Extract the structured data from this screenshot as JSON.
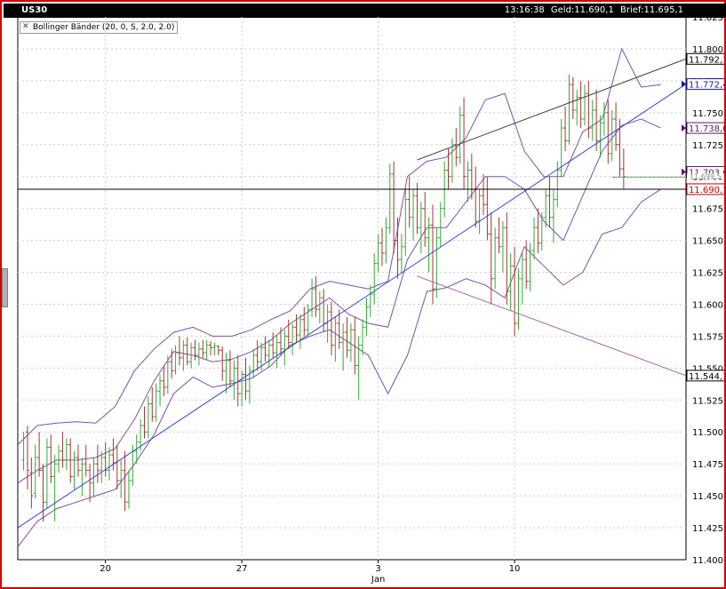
{
  "header": {
    "symbol": "US30",
    "time": "13:16:38",
    "geld": "Geld:11.690,1",
    "brief": "Brief:11.695,1"
  },
  "legend": {
    "label": "Bollinger Bänder (20, 0, S, 2.0, 2.0)"
  },
  "colors": {
    "frame": "#d40000",
    "up_bar": "#33aa33",
    "down_bar": "#aa3333",
    "bollinger": "#8050a8",
    "trend_blue": "#3048d0",
    "resistance": "#404040",
    "support": "#a060a8",
    "price_line": "#000000"
  },
  "chart_data": {
    "type": "line",
    "title": "",
    "xlabel": "",
    "ylabel": "",
    "ylim": [
      11400,
      11825
    ],
    "y_ticks": [
      "11.825,0",
      "11.800,0",
      "11.775,0",
      "11.750,0",
      "11.725,0",
      "11.700,0",
      "11.675,0",
      "11.650,0",
      "11.625,0",
      "11.600,0",
      "11.575,0",
      "11.550,0",
      "11.525,0",
      "11.500,0",
      "11.475,0",
      "11.450,0",
      "11.425,0",
      "11.400,0"
    ],
    "y_tick_values": [
      11825,
      11800,
      11775,
      11750,
      11725,
      11700,
      11675,
      11650,
      11625,
      11600,
      11575,
      11550,
      11525,
      11500,
      11475,
      11450,
      11425,
      11400
    ],
    "x_ticks": [
      {
        "label": "20",
        "x": 20
      },
      {
        "label": "27",
        "x": 27
      },
      {
        "label": "3",
        "x": 34
      },
      {
        "label": "10",
        "x": 41
      }
    ],
    "month_label": {
      "label": "Jan",
      "x": 34
    },
    "xlim": [
      15.5,
      49.8
    ],
    "grid": true,
    "price_levels": [
      {
        "label": "11.792,1",
        "value": 11792.1,
        "style": "plain"
      },
      {
        "label": "11.772,4",
        "value": 11772.4,
        "style": "blue"
      },
      {
        "label": "11.738,0",
        "value": 11738.0,
        "style": "marker"
      },
      {
        "label": "11.703,6",
        "value": 11703.6,
        "style": "marker"
      },
      {
        "label": "11.699,5",
        "value": 11699.5,
        "style": "hidden"
      },
      {
        "label": "11.690,1",
        "value": 11690.1,
        "style": "current"
      },
      {
        "label": "11.544,1",
        "value": 11544.1,
        "style": "plain"
      }
    ],
    "trend_lines": [
      {
        "name": "blue-trend",
        "points": [
          [
            15.5,
            11425
          ],
          [
            49.8,
            11772.4
          ]
        ]
      },
      {
        "name": "upper-channel",
        "points": [
          [
            36.0,
            11713
          ],
          [
            49.8,
            11792.1
          ]
        ]
      },
      {
        "name": "lower-channel",
        "points": [
          [
            36.0,
            11622
          ],
          [
            49.8,
            11544.1
          ]
        ]
      }
    ],
    "horizontal_lines": [
      {
        "name": "current-price",
        "value": 11690.1
      },
      {
        "name": "bid-level",
        "value": 11699.5,
        "from_x": 46.0
      }
    ],
    "bollinger": {
      "x": [
        15.5,
        16.5,
        17.5,
        18.5,
        19.5,
        20.5,
        21.5,
        22.5,
        23.5,
        24.5,
        25.5,
        26.5,
        27.5,
        28.5,
        29.5,
        30.5,
        31.5,
        32.5,
        33.5,
        34.5,
        35.5,
        36.5,
        37.5,
        38.5,
        39.5,
        40.5,
        41.5,
        42.5,
        43.5,
        44.5,
        45.5,
        46.5,
        47.5,
        48.5
      ],
      "upper": [
        11490,
        11505,
        11507,
        11508,
        11507,
        11520,
        11548,
        11565,
        11578,
        11582,
        11575,
        11575,
        11580,
        11588,
        11595,
        11612,
        11618,
        11615,
        11612,
        11618,
        11700,
        11712,
        11715,
        11730,
        11760,
        11765,
        11720,
        11700,
        11700,
        11735,
        11745,
        11800,
        11770,
        11772
      ],
      "middle": [
        11460,
        11470,
        11478,
        11478,
        11480,
        11487,
        11510,
        11540,
        11563,
        11560,
        11555,
        11557,
        11563,
        11572,
        11585,
        11595,
        11605,
        11592,
        11585,
        11582,
        11635,
        11660,
        11660,
        11680,
        11700,
        11700,
        11690,
        11665,
        11650,
        11685,
        11720,
        11740,
        11745,
        11738
      ],
      "lower": [
        11410,
        11430,
        11440,
        11445,
        11450,
        11455,
        11475,
        11498,
        11530,
        11543,
        11535,
        11538,
        11542,
        11552,
        11568,
        11575,
        11580,
        11570,
        11560,
        11530,
        11560,
        11610,
        11613,
        11620,
        11615,
        11605,
        11645,
        11630,
        11615,
        11625,
        11655,
        11660,
        11680,
        11690
      ]
    },
    "candles": [
      [
        15.8,
        11478,
        11500,
        11470,
        11495
      ],
      [
        16.0,
        11500,
        11505,
        11455,
        11470
      ],
      [
        16.2,
        11468,
        11480,
        11440,
        11450
      ],
      [
        16.4,
        11452,
        11490,
        11448,
        11480
      ],
      [
        16.6,
        11480,
        11500,
        11465,
        11470
      ],
      [
        16.8,
        11470,
        11475,
        11430,
        11445
      ],
      [
        17.0,
        11445,
        11495,
        11440,
        11488
      ],
      [
        17.2,
        11488,
        11498,
        11460,
        11465
      ],
      [
        17.4,
        11465,
        11482,
        11430,
        11475
      ],
      [
        17.6,
        11475,
        11490,
        11468,
        11485
      ],
      [
        17.8,
        11485,
        11500,
        11472,
        11478
      ],
      [
        18.0,
        11478,
        11495,
        11470,
        11490
      ],
      [
        18.2,
        11490,
        11495,
        11460,
        11465
      ],
      [
        18.4,
        11465,
        11485,
        11455,
        11480
      ],
      [
        18.6,
        11480,
        11490,
        11465,
        11470
      ],
      [
        18.8,
        11470,
        11480,
        11450,
        11475
      ],
      [
        19.0,
        11475,
        11490,
        11465,
        11470
      ],
      [
        19.2,
        11470,
        11475,
        11445,
        11460
      ],
      [
        19.4,
        11460,
        11480,
        11450,
        11475
      ],
      [
        19.6,
        11475,
        11490,
        11460,
        11470
      ],
      [
        19.8,
        11470,
        11485,
        11460,
        11480
      ],
      [
        20.0,
        11480,
        11492,
        11465,
        11470
      ],
      [
        20.2,
        11470,
        11488,
        11462,
        11482
      ],
      [
        20.4,
        11482,
        11495,
        11470,
        11476
      ],
      [
        20.6,
        11476,
        11490,
        11455,
        11462
      ],
      [
        20.8,
        11462,
        11478,
        11448,
        11470
      ],
      [
        21.0,
        11470,
        11485,
        11438,
        11445
      ],
      [
        21.2,
        11445,
        11470,
        11440,
        11462
      ],
      [
        21.4,
        11462,
        11490,
        11458,
        11485
      ],
      [
        21.6,
        11485,
        11498,
        11475,
        11492
      ],
      [
        21.8,
        11492,
        11510,
        11485,
        11505
      ],
      [
        22.0,
        11505,
        11520,
        11495,
        11500
      ],
      [
        22.2,
        11500,
        11528,
        11495,
        11522
      ],
      [
        22.4,
        11522,
        11535,
        11508,
        11512
      ],
      [
        22.6,
        11512,
        11538,
        11508,
        11532
      ],
      [
        22.8,
        11532,
        11545,
        11520,
        11540
      ],
      [
        23.0,
        11540,
        11552,
        11528,
        11535
      ],
      [
        23.2,
        11535,
        11560,
        11530,
        11555
      ],
      [
        23.4,
        11555,
        11565,
        11542,
        11548
      ],
      [
        23.6,
        11548,
        11568,
        11545,
        11562
      ],
      [
        23.8,
        11562,
        11575,
        11552,
        11558
      ],
      [
        24.0,
        11558,
        11572,
        11548,
        11568
      ],
      [
        24.2,
        11568,
        11574,
        11552,
        11555
      ],
      [
        24.4,
        11555,
        11570,
        11550,
        11566
      ],
      [
        24.6,
        11566,
        11572,
        11556,
        11560
      ],
      [
        24.8,
        11560,
        11570,
        11552,
        11565
      ],
      [
        25.0,
        11565,
        11572,
        11558,
        11562
      ],
      [
        25.2,
        11562,
        11572,
        11556,
        11568
      ],
      [
        25.4,
        11568,
        11571,
        11560,
        11566
      ],
      [
        25.6,
        11566,
        11570,
        11560,
        11567
      ],
      [
        25.8,
        11567,
        11568,
        11560,
        11564
      ],
      [
        26.0,
        11564,
        11567,
        11540,
        11548
      ],
      [
        26.2,
        11548,
        11562,
        11530,
        11556
      ],
      [
        26.4,
        11556,
        11564,
        11535,
        11540
      ],
      [
        26.6,
        11540,
        11556,
        11525,
        11550
      ],
      [
        26.8,
        11550,
        11560,
        11520,
        11530
      ],
      [
        27.0,
        11530,
        11548,
        11520,
        11545
      ],
      [
        27.2,
        11545,
        11558,
        11525,
        11532
      ],
      [
        27.4,
        11532,
        11552,
        11522,
        11548
      ],
      [
        27.6,
        11548,
        11565,
        11542,
        11560
      ],
      [
        27.8,
        11560,
        11572,
        11548,
        11555
      ],
      [
        28.0,
        11555,
        11570,
        11548,
        11566
      ],
      [
        28.2,
        11566,
        11575,
        11555,
        11560
      ],
      [
        28.4,
        11560,
        11572,
        11550,
        11568
      ],
      [
        28.6,
        11568,
        11578,
        11558,
        11562
      ],
      [
        28.8,
        11562,
        11576,
        11550,
        11570
      ],
      [
        29.0,
        11570,
        11582,
        11560,
        11565
      ],
      [
        29.2,
        11565,
        11580,
        11552,
        11575
      ],
      [
        29.4,
        11575,
        11588,
        11565,
        11570
      ],
      [
        29.6,
        11570,
        11585,
        11560,
        11582
      ],
      [
        29.8,
        11582,
        11592,
        11570,
        11576
      ],
      [
        30.0,
        11576,
        11592,
        11565,
        11588
      ],
      [
        30.2,
        11588,
        11598,
        11575,
        11580
      ],
      [
        30.4,
        11580,
        11600,
        11576,
        11596
      ],
      [
        30.6,
        11596,
        11620,
        11590,
        11612
      ],
      [
        30.8,
        11612,
        11622,
        11590,
        11596
      ],
      [
        31.0,
        11596,
        11610,
        11585,
        11605
      ],
      [
        31.2,
        11605,
        11612,
        11578,
        11585
      ],
      [
        31.4,
        11585,
        11600,
        11570,
        11594
      ],
      [
        31.6,
        11594,
        11602,
        11560,
        11568
      ],
      [
        31.8,
        11568,
        11590,
        11555,
        11585
      ],
      [
        32.0,
        11585,
        11596,
        11565,
        11570
      ],
      [
        32.2,
        11570,
        11585,
        11548,
        11578
      ],
      [
        32.4,
        11578,
        11590,
        11558,
        11564
      ],
      [
        32.6,
        11564,
        11585,
        11555,
        11580
      ],
      [
        32.8,
        11580,
        11590,
        11545,
        11552
      ],
      [
        33.0,
        11552,
        11575,
        11525,
        11568
      ],
      [
        33.2,
        11568,
        11588,
        11560,
        11582
      ],
      [
        33.4,
        11582,
        11605,
        11575,
        11598
      ],
      [
        33.6,
        11598,
        11615,
        11590,
        11608
      ],
      [
        33.8,
        11608,
        11640,
        11600,
        11632
      ],
      [
        34.0,
        11632,
        11655,
        11625,
        11648
      ],
      [
        34.2,
        11648,
        11660,
        11630,
        11640
      ],
      [
        34.4,
        11640,
        11668,
        11632,
        11660
      ],
      [
        34.6,
        11660,
        11710,
        11655,
        11702
      ],
      [
        34.8,
        11702,
        11712,
        11640,
        11650
      ],
      [
        35.0,
        11650,
        11668,
        11620,
        11635
      ],
      [
        35.2,
        11635,
        11655,
        11625,
        11645
      ],
      [
        35.4,
        11645,
        11690,
        11638,
        11682
      ],
      [
        35.6,
        11682,
        11700,
        11660,
        11668
      ],
      [
        35.8,
        11668,
        11690,
        11650,
        11685
      ],
      [
        36.0,
        11685,
        11695,
        11655,
        11660
      ],
      [
        36.2,
        11660,
        11680,
        11640,
        11675
      ],
      [
        36.4,
        11675,
        11688,
        11645,
        11652
      ],
      [
        36.6,
        11652,
        11668,
        11625,
        11662
      ],
      [
        36.8,
        11662,
        11678,
        11600,
        11612
      ],
      [
        37.0,
        11612,
        11660,
        11605,
        11652
      ],
      [
        37.2,
        11652,
        11680,
        11645,
        11675
      ],
      [
        37.4,
        11675,
        11712,
        11668,
        11705
      ],
      [
        37.6,
        11705,
        11722,
        11690,
        11700
      ],
      [
        37.8,
        11700,
        11730,
        11695,
        11725
      ],
      [
        38.0,
        11725,
        11738,
        11708,
        11715
      ],
      [
        38.2,
        11715,
        11755,
        11710,
        11748
      ],
      [
        38.4,
        11748,
        11762,
        11690,
        11700
      ],
      [
        38.6,
        11700,
        11712,
        11680,
        11705
      ],
      [
        38.8,
        11705,
        11718,
        11682,
        11690
      ],
      [
        39.0,
        11690,
        11708,
        11660,
        11665
      ],
      [
        39.2,
        11665,
        11690,
        11655,
        11685
      ],
      [
        39.4,
        11685,
        11702,
        11670,
        11678
      ],
      [
        39.6,
        11678,
        11700,
        11650,
        11655
      ],
      [
        39.8,
        11655,
        11672,
        11600,
        11620
      ],
      [
        40.0,
        11620,
        11660,
        11612,
        11652
      ],
      [
        40.2,
        11652,
        11668,
        11640,
        11645
      ],
      [
        40.4,
        11645,
        11665,
        11625,
        11660
      ],
      [
        40.6,
        11660,
        11672,
        11600,
        11610
      ],
      [
        40.8,
        11610,
        11640,
        11595,
        11630
      ],
      [
        41.0,
        11630,
        11645,
        11575,
        11585
      ],
      [
        41.2,
        11585,
        11628,
        11580,
        11620
      ],
      [
        41.4,
        11620,
        11640,
        11600,
        11635
      ],
      [
        41.6,
        11635,
        11650,
        11612,
        11618
      ],
      [
        41.8,
        11618,
        11648,
        11610,
        11642
      ],
      [
        42.0,
        11642,
        11668,
        11635,
        11660
      ],
      [
        42.2,
        11660,
        11675,
        11640,
        11648
      ],
      [
        42.4,
        11648,
        11672,
        11642,
        11668
      ],
      [
        42.6,
        11668,
        11690,
        11660,
        11685
      ],
      [
        42.8,
        11685,
        11700,
        11660,
        11668
      ],
      [
        43.0,
        11668,
        11690,
        11648,
        11682
      ],
      [
        43.2,
        11682,
        11712,
        11676,
        11705
      ],
      [
        43.4,
        11705,
        11745,
        11700,
        11738
      ],
      [
        43.6,
        11738,
        11755,
        11720,
        11728
      ],
      [
        43.8,
        11728,
        11780,
        11725,
        11772
      ],
      [
        44.0,
        11772,
        11778,
        11745,
        11752
      ],
      [
        44.2,
        11752,
        11768,
        11740,
        11762
      ],
      [
        44.4,
        11762,
        11775,
        11738,
        11745
      ],
      [
        44.6,
        11745,
        11772,
        11740,
        11765
      ],
      [
        44.8,
        11765,
        11775,
        11730,
        11738
      ],
      [
        45.0,
        11738,
        11760,
        11728,
        11752
      ],
      [
        45.2,
        11752,
        11768,
        11720,
        11728
      ],
      [
        45.4,
        11728,
        11748,
        11715,
        11742
      ],
      [
        45.6,
        11742,
        11758,
        11732,
        11750
      ],
      [
        45.8,
        11750,
        11760,
        11710,
        11718
      ],
      [
        46.0,
        11718,
        11752,
        11712,
        11745
      ],
      [
        46.2,
        11745,
        11758,
        11720,
        11725
      ],
      [
        46.4,
        11725,
        11745,
        11700,
        11706
      ],
      [
        46.6,
        11706,
        11722,
        11690,
        11700
      ]
    ]
  }
}
